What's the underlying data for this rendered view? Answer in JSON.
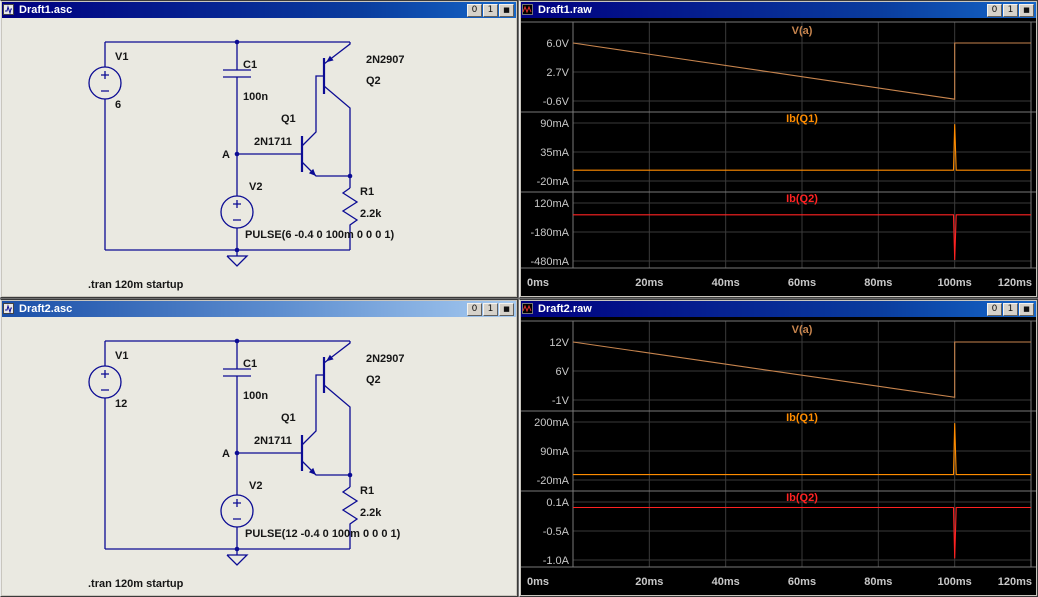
{
  "app": {
    "name": "LTspice"
  },
  "windows": [
    {
      "id": "draft1_asc",
      "title": "Draft1.asc",
      "kind": "schematic",
      "buttons": [
        "0",
        "1",
        "■"
      ],
      "schematic": {
        "v1_name": "V1",
        "v1_value": "6",
        "c1_name": "C1",
        "c1_value": "100n",
        "q1_name": "Q1",
        "q1_model": "2N1711",
        "q2_name": "Q2",
        "q2_model": "2N2907",
        "node_a": "A",
        "v2_name": "V2",
        "v2_value": "PULSE(6 -0.4 0 100m 0 0 0 1)",
        "r1_name": "R1",
        "r1_value": "2.2k",
        "directive": ".tran 120m startup"
      }
    },
    {
      "id": "draft1_raw",
      "title": "Draft1.raw",
      "kind": "waveform",
      "buttons": [
        "0",
        "1",
        "■"
      ],
      "chart": {
        "type": "line",
        "x_range": [
          0,
          120
        ],
        "x_ticks": [
          {
            "label": "0ms",
            "t": 0
          },
          {
            "label": "20ms",
            "t": 20
          },
          {
            "label": "40ms",
            "t": 40
          },
          {
            "label": "60ms",
            "t": 60
          },
          {
            "label": "80ms",
            "t": 80
          },
          {
            "label": "100ms",
            "t": 100
          },
          {
            "label": "120ms",
            "t": 120
          }
        ],
        "panes": [
          {
            "title": "V(a)",
            "color": "#c8854e",
            "unit": "V",
            "y_gridlines": [
              {
                "label": "6.0V",
                "value": 6.0
              },
              {
                "label": "2.7V",
                "value": 2.7
              },
              {
                "label": "-0.6V",
                "value": -0.6
              }
            ],
            "trace": [
              [
                0,
                6.0
              ],
              [
                100,
                -0.4
              ],
              [
                100,
                6.0
              ],
              [
                120,
                6.0
              ]
            ]
          },
          {
            "title": "Ib(Q1)",
            "color": "#ff8c00",
            "unit": "mA",
            "y_gridlines": [
              {
                "label": "90mA",
                "value": 90
              },
              {
                "label": "35mA",
                "value": 35
              },
              {
                "label": "-20mA",
                "value": -20
              }
            ],
            "trace": [
              [
                0,
                0.4
              ],
              [
                99.7,
                0.4
              ],
              [
                100,
                88
              ],
              [
                100.4,
                0.4
              ],
              [
                120,
                0.4
              ]
            ]
          },
          {
            "title": "Ib(Q2)",
            "color": "#ff2222",
            "unit": "mA",
            "y_gridlines": [
              {
                "label": "120mA",
                "value": 120
              },
              {
                "label": "-180mA",
                "value": -180
              },
              {
                "label": "-480mA",
                "value": -480
              }
            ],
            "trace": [
              [
                0,
                -2
              ],
              [
                99.7,
                -2
              ],
              [
                100,
                -470
              ],
              [
                100.4,
                -2
              ],
              [
                120,
                -2
              ]
            ]
          }
        ]
      }
    },
    {
      "id": "draft2_asc",
      "title": "Draft2.asc",
      "kind": "schematic",
      "buttons": [
        "0",
        "1",
        "■"
      ],
      "schematic": {
        "v1_name": "V1",
        "v1_value": "12",
        "c1_name": "C1",
        "c1_value": "100n",
        "q1_name": "Q1",
        "q1_model": "2N1711",
        "q2_name": "Q2",
        "q2_model": "2N2907",
        "node_a": "A",
        "v2_name": "V2",
        "v2_value": "PULSE(12 -0.4 0 100m 0 0 0 1)",
        "r1_name": "R1",
        "r1_value": "2.2k",
        "directive": ".tran 120m startup"
      }
    },
    {
      "id": "draft2_raw",
      "title": "Draft2.raw",
      "kind": "waveform",
      "buttons": [
        "0",
        "1",
        "■"
      ],
      "chart": {
        "type": "line",
        "x_range": [
          0,
          120
        ],
        "x_ticks": [
          {
            "label": "0ms",
            "t": 0
          },
          {
            "label": "20ms",
            "t": 20
          },
          {
            "label": "40ms",
            "t": 40
          },
          {
            "label": "60ms",
            "t": 60
          },
          {
            "label": "80ms",
            "t": 80
          },
          {
            "label": "100ms",
            "t": 100
          },
          {
            "label": "120ms",
            "t": 120
          }
        ],
        "panes": [
          {
            "title": "V(a)",
            "color": "#c8854e",
            "unit": "V",
            "y_gridlines": [
              {
                "label": "12V",
                "value": 12
              },
              {
                "label": "6V",
                "value": 6
              },
              {
                "label": "-1V",
                "value": -1
              }
            ],
            "trace": [
              [
                0,
                12
              ],
              [
                100,
                -0.4
              ],
              [
                100,
                12
              ],
              [
                120,
                12
              ]
            ]
          },
          {
            "title": "Ib(Q1)",
            "color": "#ff8c00",
            "unit": "mA",
            "y_gridlines": [
              {
                "label": "200mA",
                "value": 200
              },
              {
                "label": "90mA",
                "value": 90
              },
              {
                "label": "-20mA",
                "value": -20
              }
            ],
            "trace": [
              [
                0,
                0.5
              ],
              [
                99.7,
                0.5
              ],
              [
                100,
                196
              ],
              [
                100.4,
                0.5
              ],
              [
                120,
                0.5
              ]
            ]
          },
          {
            "title": "Ib(Q2)",
            "color": "#ff2222",
            "unit": "A",
            "y_gridlines": [
              {
                "label": "0.1A",
                "value": 0.1
              },
              {
                "label": "-0.5A",
                "value": -0.5
              },
              {
                "label": "-1.0A",
                "value": -1.0
              }
            ],
            "trace": [
              [
                0,
                -0.005
              ],
              [
                99.7,
                -0.005
              ],
              [
                100,
                -0.97
              ],
              [
                100.4,
                -0.005
              ],
              [
                120,
                -0.005
              ]
            ]
          }
        ]
      }
    }
  ],
  "colors": {
    "grid": "#3a3a3a",
    "pane_border": "#787878",
    "axis_text": "#c8c8c8",
    "wire": "#0c0c94",
    "schematic_bg": "#eae9e1"
  }
}
